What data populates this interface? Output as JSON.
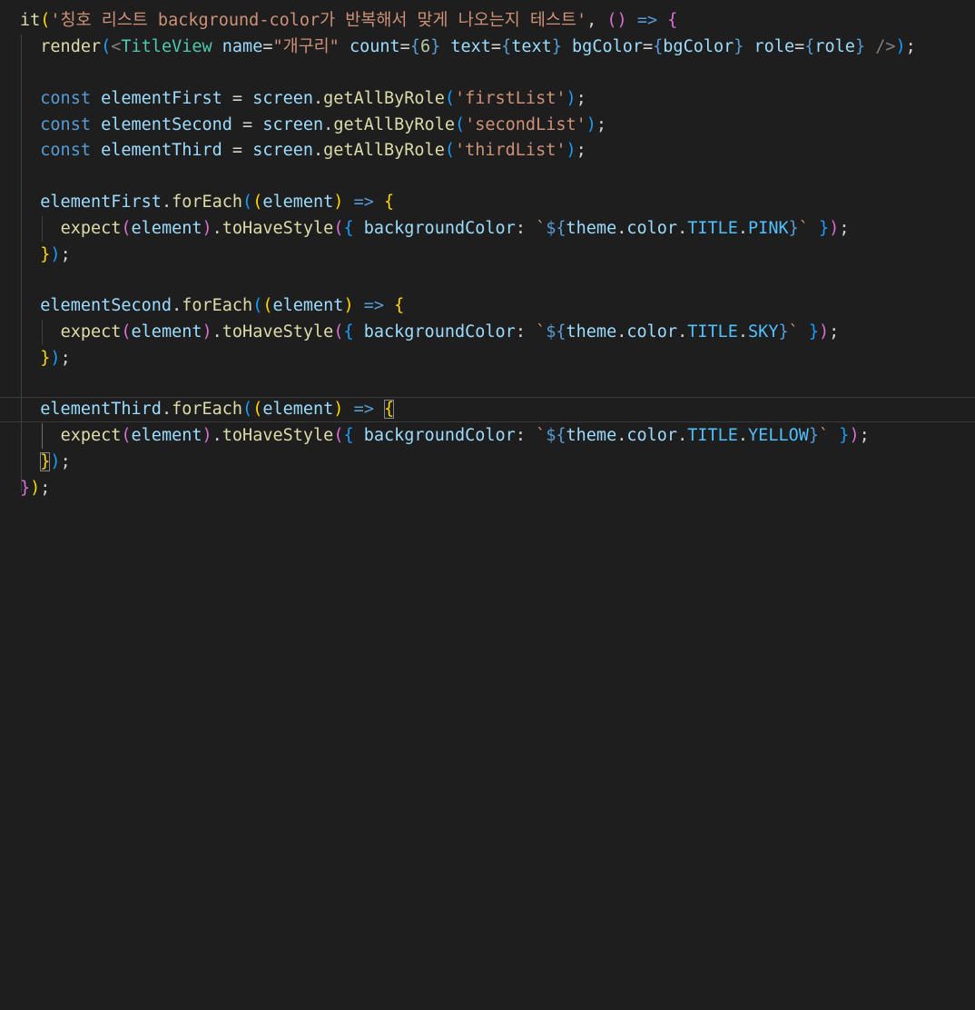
{
  "code": {
    "l1": {
      "fn": "it",
      "p1": "(",
      "str": "'칭호 리스트 background-color가 반복해서 맞게 나오는지 테스트'",
      "comma": ", ",
      "p2": "()",
      "arrow": " => ",
      "brace": "{"
    },
    "l2": {
      "fn": "render",
      "p1": "(",
      "lt": "<",
      "tag": "TitleView",
      "a1": " name",
      "eq1": "=",
      "v1": "\"개구리\"",
      "a2": " count",
      "eq2": "=",
      "o2": "{",
      "v2": "6",
      "c2": "}",
      "a3": " text",
      "eq3": "=",
      "o3": "{",
      "v3": "text",
      "c3": "}",
      "a4": " bgColor",
      "eq4": "=",
      "o4": "{",
      "v4": "bgColor",
      "c4": "}",
      "a5": " role",
      "eq5": "=",
      "o5": "{",
      "v5": "role",
      "c5": "}",
      "close": " />",
      "p2": ")",
      "semi": ";"
    },
    "l4": {
      "kw": "const",
      "name": " elementFirst",
      "eq": " = ",
      "obj": "screen",
      "dot": ".",
      "fn": "getAllByRole",
      "p1": "(",
      "str": "'firstList'",
      "p2": ")",
      "semi": ";"
    },
    "l5": {
      "kw": "const",
      "name": " elementSecond",
      "eq": " = ",
      "obj": "screen",
      "dot": ".",
      "fn": "getAllByRole",
      "p1": "(",
      "str": "'secondList'",
      "p2": ")",
      "semi": ";"
    },
    "l6": {
      "kw": "const",
      "name": " elementThird",
      "eq": " = ",
      "obj": "screen",
      "dot": ".",
      "fn": "getAllByRole",
      "p1": "(",
      "str": "'thirdList'",
      "p2": ")",
      "semi": ";"
    },
    "l8": {
      "name": "elementFirst",
      "dot": ".",
      "fn": "forEach",
      "p1": "(",
      "p2": "(",
      "param": "element",
      "p3": ")",
      "arrow": " => ",
      "brace": "{"
    },
    "l9": {
      "fn": "expect",
      "p1": "(",
      "arg": "element",
      "p2": ")",
      "dot": ".",
      "fn2": "toHaveStyle",
      "p3": "(",
      "o": "{",
      "key": " backgroundColor",
      "colon": ": ",
      "bt1": "`",
      "do": "${",
      "th": "theme",
      "d1": ".",
      "cl": "color",
      "d2": ".",
      "ti": "TITLE",
      "d3": ".",
      "val": "PINK",
      "dc": "}",
      "bt2": "`",
      "c": " }",
      "p4": ")",
      "semi": ";"
    },
    "l10": {
      "brace": "}",
      "p": ")",
      "semi": ";"
    },
    "l12": {
      "name": "elementSecond",
      "dot": ".",
      "fn": "forEach",
      "p1": "(",
      "p2": "(",
      "param": "element",
      "p3": ")",
      "arrow": " => ",
      "brace": "{"
    },
    "l13": {
      "fn": "expect",
      "p1": "(",
      "arg": "element",
      "p2": ")",
      "dot": ".",
      "fn2": "toHaveStyle",
      "p3": "(",
      "o": "{",
      "key": " backgroundColor",
      "colon": ": ",
      "bt1": "`",
      "do": "${",
      "th": "theme",
      "d1": ".",
      "cl": "color",
      "d2": ".",
      "ti": "TITLE",
      "d3": ".",
      "val": "SKY",
      "dc": "}",
      "bt2": "`",
      "c": " }",
      "p4": ")",
      "semi": ";"
    },
    "l14": {
      "brace": "}",
      "p": ")",
      "semi": ";"
    },
    "l16": {
      "name": "elementThird",
      "dot": ".",
      "fn": "forEach",
      "p1": "(",
      "p2": "(",
      "param": "element",
      "p3": ")",
      "arrow": " => ",
      "brace": "{"
    },
    "l17": {
      "fn": "expect",
      "p1": "(",
      "arg": "element",
      "p2": ")",
      "dot": ".",
      "fn2": "toHaveStyle",
      "p3": "(",
      "o": "{",
      "key": " backgroundColor",
      "colon": ": ",
      "bt1": "`",
      "do": "${",
      "th": "theme",
      "d1": ".",
      "cl": "color",
      "d2": ".",
      "ti": "TITLE",
      "d3": ".",
      "val": "YELLOW",
      "dc": "}",
      "bt2": "`",
      "c": " }",
      "p4": ")",
      "semi": ";"
    },
    "l18": {
      "brace": "}",
      "p": ")",
      "semi": ";"
    },
    "l19": {
      "brace": "}",
      "p": ")",
      "semi": ";"
    }
  },
  "colors": {
    "background": "#1e1e1e",
    "function": "#dcdcaa",
    "variable": "#9cdcfe",
    "keyword": "#569cd6",
    "string": "#ce9178",
    "number": "#b5cea8",
    "jsx_tag": "#4ec9b0",
    "bracket_level1": "#ffd700",
    "bracket_level2": "#da70d6",
    "bracket_level3": "#179fff"
  }
}
